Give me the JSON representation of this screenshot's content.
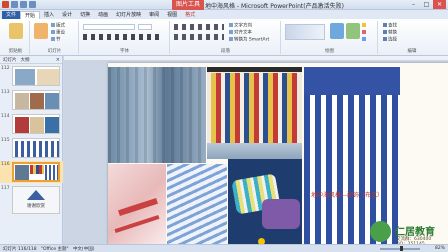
{
  "titlebar": {
    "title": "地中海风格 - Microsoft PowerPoint(产品激活失败)",
    "context_badge": "图片工具",
    "minimize": "–",
    "maximize": "□",
    "close": "✕"
  },
  "tabs": [
    "文件",
    "开始",
    "插入",
    "设计",
    "切换",
    "动画",
    "幻灯片放映",
    "审阅",
    "视图",
    "格式"
  ],
  "ribbon": {
    "groups": [
      {
        "label": "剪贴板"
      },
      {
        "label": "幻灯片"
      },
      {
        "label": "字体"
      },
      {
        "label": "段落"
      },
      {
        "label": "绘图"
      },
      {
        "label": "编辑"
      }
    ],
    "slide_buttons": [
      "新建",
      "版式",
      "重设",
      "节"
    ],
    "paragraph_items": [
      "文字方向",
      "对齐文本",
      "转换为 SmartArt"
    ],
    "drawing_items": [
      "快速样式"
    ],
    "editing_items": [
      "查找",
      "替换",
      "选择"
    ]
  },
  "leftpane": {
    "tab_outline": "幻灯片",
    "tab_slides": "大纲",
    "close": "×",
    "slides": [
      {
        "num": "112"
      },
      {
        "num": "113"
      },
      {
        "num": "114"
      },
      {
        "num": "115"
      },
      {
        "num": "116"
      },
      {
        "num": "117",
        "caption": "谢谢欣赏"
      }
    ]
  },
  "slide": {
    "caption": "地中海风格—配饰（布艺）"
  },
  "statusbar": {
    "slide_info": "幻灯片 116/118",
    "theme": "\"Office 主题\"",
    "language": "中文(中国)",
    "zoom": "82%"
  },
  "watermark": {
    "brand": "仁居教育",
    "line1": "交流群：630400",
    "line2": "QQ：251145"
  },
  "colors": {
    "file_tab": "#2f5fa7",
    "context_red": "#d9534f",
    "caption_red": "#c0392b",
    "brand_green": "#2e7d32"
  }
}
